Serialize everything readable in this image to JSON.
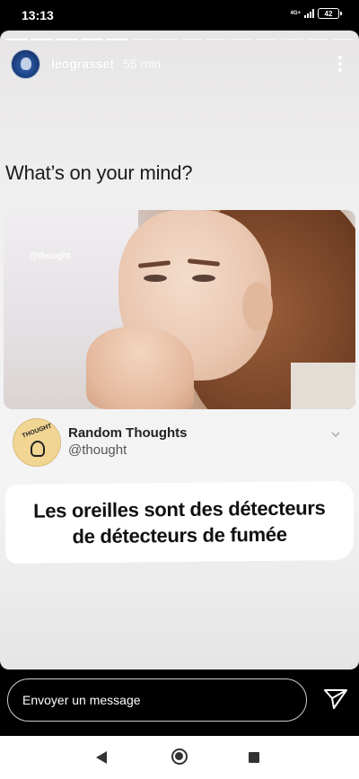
{
  "status_bar": {
    "time": "13:13",
    "network_label": "4G+",
    "battery": "42"
  },
  "story": {
    "progress_segments_total": 14,
    "progress_segments_done": 5,
    "username": "leograsset",
    "time_ago": "55 min."
  },
  "post": {
    "prompt": "What’s on your mind?",
    "image_watermark": "@thought",
    "account_name": "Random Thoughts",
    "account_handle": "@thought",
    "avatar_text": "THOUGHT"
  },
  "caption": {
    "line1": "Les oreilles sont des détecteurs",
    "line2": "de détecteurs de fumée"
  },
  "message_bar": {
    "placeholder": "Envoyer un message"
  },
  "icons": {
    "more": "more-vertical-icon",
    "send": "send-icon",
    "chevron": "chevron-down-icon",
    "back": "back-icon",
    "home": "home-icon",
    "recent": "recent-apps-icon"
  }
}
